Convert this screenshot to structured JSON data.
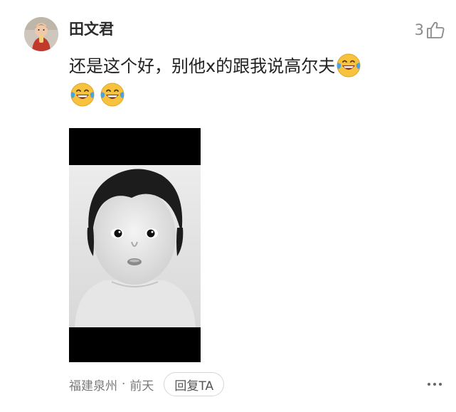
{
  "comment": {
    "username": "田文君",
    "like_count": "3",
    "text": "还是这个好，别他x的跟我说高尔夫",
    "emojis": [
      "laughing-tears-emoji",
      "laughing-tears-emoji",
      "laughing-tears-emoji"
    ],
    "location": "福建泉州",
    "separator": "·",
    "time": "前天",
    "reply_label": "回复TA"
  },
  "icons": {
    "like": "thumbs-up-icon",
    "more": "more-dots-icon"
  },
  "colors": {
    "username": "#2b2b2b",
    "meta_text": "#7a7a7a",
    "emoji_yellow": "#f7c23d",
    "emoji_tear": "#4aa3df"
  }
}
